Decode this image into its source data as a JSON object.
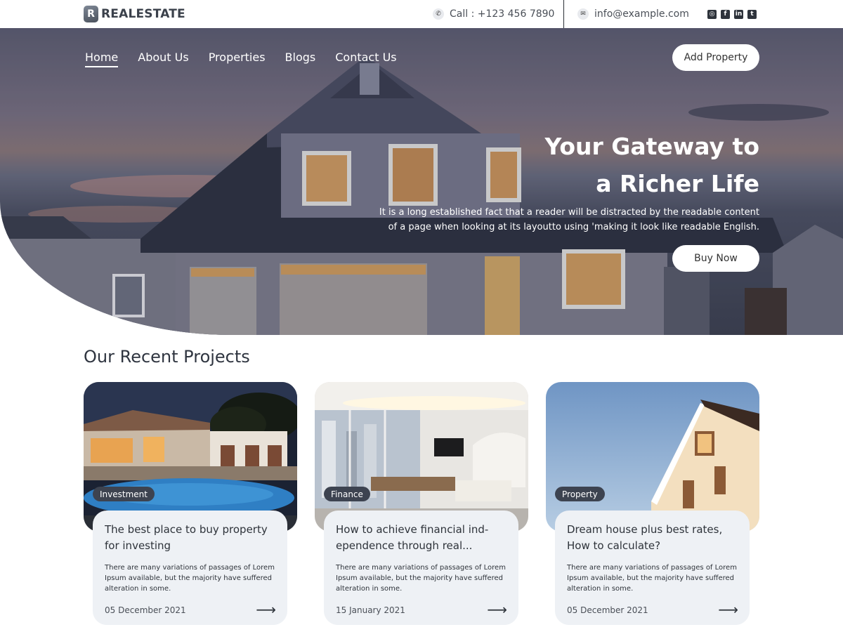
{
  "brand": {
    "logo_letter": "R",
    "name": "REALESTATE"
  },
  "topbar": {
    "phone": "Call : +123 456 7890",
    "email": "info@example.com",
    "phone_icon": "phone-icon",
    "mail_icon": "mail-icon",
    "socials": [
      "instagram-icon",
      "facebook-icon",
      "linkedin-icon",
      "twitter-icon"
    ]
  },
  "nav": {
    "items": [
      "Home",
      "About Us",
      "Properties",
      "Blogs",
      "Contact Us"
    ],
    "active": "Home",
    "add_property": "Add Property"
  },
  "hero": {
    "title_line1": "Your Gateway to",
    "title_line2": "a Richer Life",
    "sub_line1": "It is a long established fact that a reader will be distracted by the readable content",
    "sub_line2": "of a page when looking at its layoutto using 'making it look like readable English.",
    "cta": "Buy Now"
  },
  "projects": {
    "title": "Our Recent Projects",
    "cards": [
      {
        "tag": "Investment",
        "title": "The best place to buy property for investing",
        "text": "There are many variations of passages  of Lorem Ipsum available, but the majority  have suffered alteration in some.",
        "date": "05 December 2021"
      },
      {
        "tag": "Finance",
        "title": "How to achieve financial ind-ependence through real...",
        "text": "There are many variations of passages  of Lorem Ipsum available, but the majority  have suffered alteration in some.",
        "date": "15 January 2021"
      },
      {
        "tag": "Property",
        "title": "Dream house plus best rates, How to calculate?",
        "text": "There are many variations of passages  of Lorem Ipsum available, but the majority  have suffered alteration in some.",
        "date": "05 December 2021"
      }
    ]
  },
  "colors": {
    "accent_dark": "#3d4350",
    "card_bg": "#eef1f5",
    "text": "#2e333a"
  }
}
